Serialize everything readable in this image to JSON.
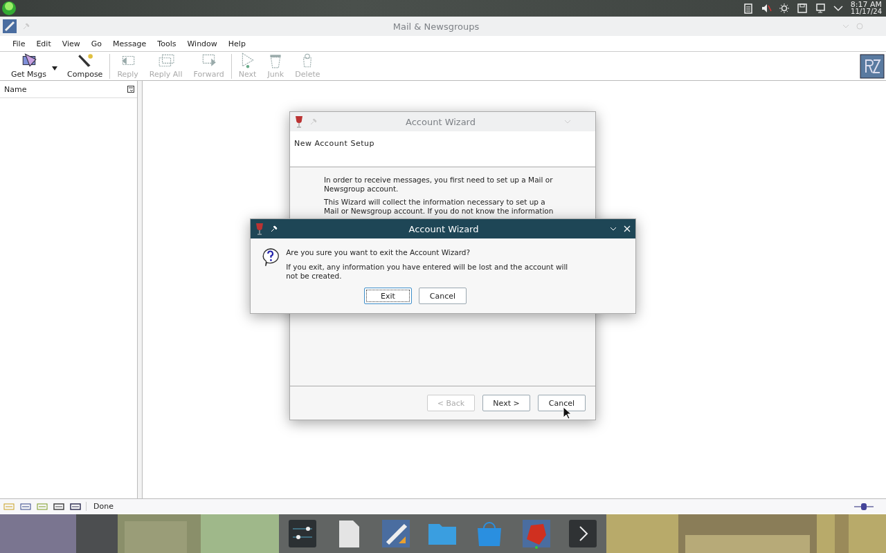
{
  "top_panel": {
    "time": "8:17 AM",
    "date": "11/17/24"
  },
  "window": {
    "title": "Mail & Newsgroups",
    "active": false
  },
  "menu": [
    "File",
    "Edit",
    "View",
    "Go",
    "Message",
    "Tools",
    "Window",
    "Help"
  ],
  "toolbar": [
    {
      "label": "Get Msgs",
      "disabled": false,
      "kind": "getmsgs"
    },
    {
      "label": "Compose",
      "disabled": false,
      "kind": "compose"
    },
    {
      "label": "Reply",
      "disabled": true,
      "kind": "reply"
    },
    {
      "label": "Reply All",
      "disabled": true,
      "kind": "replyall"
    },
    {
      "label": "Forward",
      "disabled": true,
      "kind": "forward"
    },
    {
      "label": "Next",
      "disabled": true,
      "kind": "next"
    },
    {
      "label": "Junk",
      "disabled": true,
      "kind": "junk"
    },
    {
      "label": "Delete",
      "disabled": true,
      "kind": "delete"
    }
  ],
  "folder_pane": {
    "column": "Name"
  },
  "status_bar": {
    "text": "Done"
  },
  "wizard": {
    "title": "Account Wizard",
    "active": false,
    "heading": "New Account Setup",
    "paragraphs": [
      "In order to receive messages, you first need to set up a Mail or Newsgroup account.",
      "This Wizard will collect the information necessary to set up a Mail or Newsgroup account. If you do not know the information"
    ],
    "buttons": [
      {
        "label": "< Back",
        "disabled": true
      },
      {
        "label": "Next >",
        "disabled": false
      },
      {
        "label": "Cancel",
        "disabled": false
      }
    ]
  },
  "confirm": {
    "title": "Account Wizard",
    "active": true,
    "question": "Are you sure you want to exit the Account Wizard?",
    "detail": "If you exit, any information you have entered will be lost and the account will not be created.",
    "buttons": [
      {
        "label": "Exit",
        "focused": true
      },
      {
        "label": "Cancel",
        "focused": false
      }
    ]
  }
}
